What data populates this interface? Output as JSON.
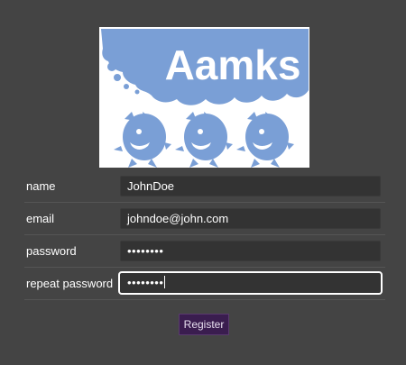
{
  "logo": {
    "text": "Aamks",
    "icon": "aamks-logo-icon"
  },
  "form": {
    "fields": [
      {
        "label": "name",
        "value": "JohnDoe",
        "type": "text"
      },
      {
        "label": "email",
        "value": "johndoe@john.com",
        "type": "text"
      },
      {
        "label": "password",
        "value": "••••••••",
        "type": "password"
      },
      {
        "label": "repeat password",
        "value": "••••••••",
        "type": "password",
        "focused": true
      }
    ],
    "submit_label": "Register"
  },
  "colors": {
    "background": "#444444",
    "logo_blue": "#7a9fd6",
    "button_bg": "#3a1d4f"
  }
}
